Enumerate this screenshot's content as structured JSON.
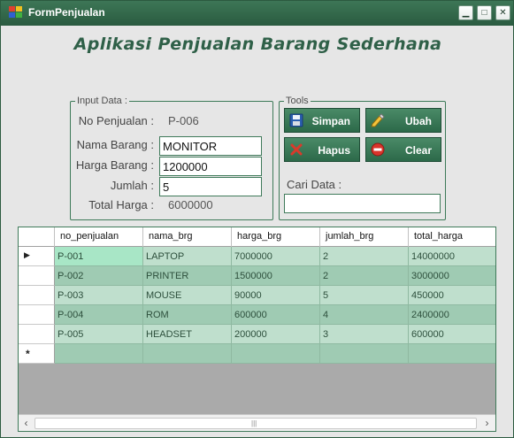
{
  "window": {
    "title": "FormPenjualan",
    "controls": {
      "minimize": "▁",
      "maximize": "□",
      "close": "✕"
    }
  },
  "app_title": "Aplikasi Penjualan Barang Sederhana",
  "input_data": {
    "group_title": "Input Data :",
    "no_penjualan_label": "No Penjualan :",
    "no_penjualan_value": "P-006",
    "nama_barang_label": "Nama Barang :",
    "nama_barang_value": "MONITOR",
    "harga_barang_label": "Harga Barang :",
    "harga_barang_value": "1200000",
    "jumlah_label": "Jumlah :",
    "jumlah_value": "5",
    "total_harga_label": "Total Harga :",
    "total_harga_value": "6000000"
  },
  "tools": {
    "group_title": "Tools",
    "simpan": "Simpan",
    "ubah": "Ubah",
    "hapus": "Hapus",
    "clear": "Clear",
    "cari_label": "Cari Data :",
    "cari_value": ""
  },
  "grid": {
    "columns": [
      "no_penjualan",
      "nama_brg",
      "harga_brg",
      "jumlah_brg",
      "total_harga"
    ],
    "rows": [
      [
        "P-001",
        "LAPTOP",
        "7000000",
        "2",
        "14000000"
      ],
      [
        "P-002",
        "PRINTER",
        "1500000",
        "2",
        "3000000"
      ],
      [
        "P-003",
        "MOUSE",
        "90000",
        "5",
        "450000"
      ],
      [
        "P-004",
        "ROM",
        "600000",
        "4",
        "2400000"
      ],
      [
        "P-005",
        "HEADSET",
        "200000",
        "3",
        "600000"
      ]
    ],
    "current_row_marker": "▶",
    "new_row_marker": "*"
  },
  "scrollbar": {
    "left": "‹",
    "right": "›",
    "grip": "|||"
  },
  "colors": {
    "titlebar": "#2f6048",
    "button": "#3a7a57",
    "grid_row": "#bfdfcd",
    "grid_row_alt": "#9fcbb3",
    "selected_cell": "#a8e6c6"
  }
}
